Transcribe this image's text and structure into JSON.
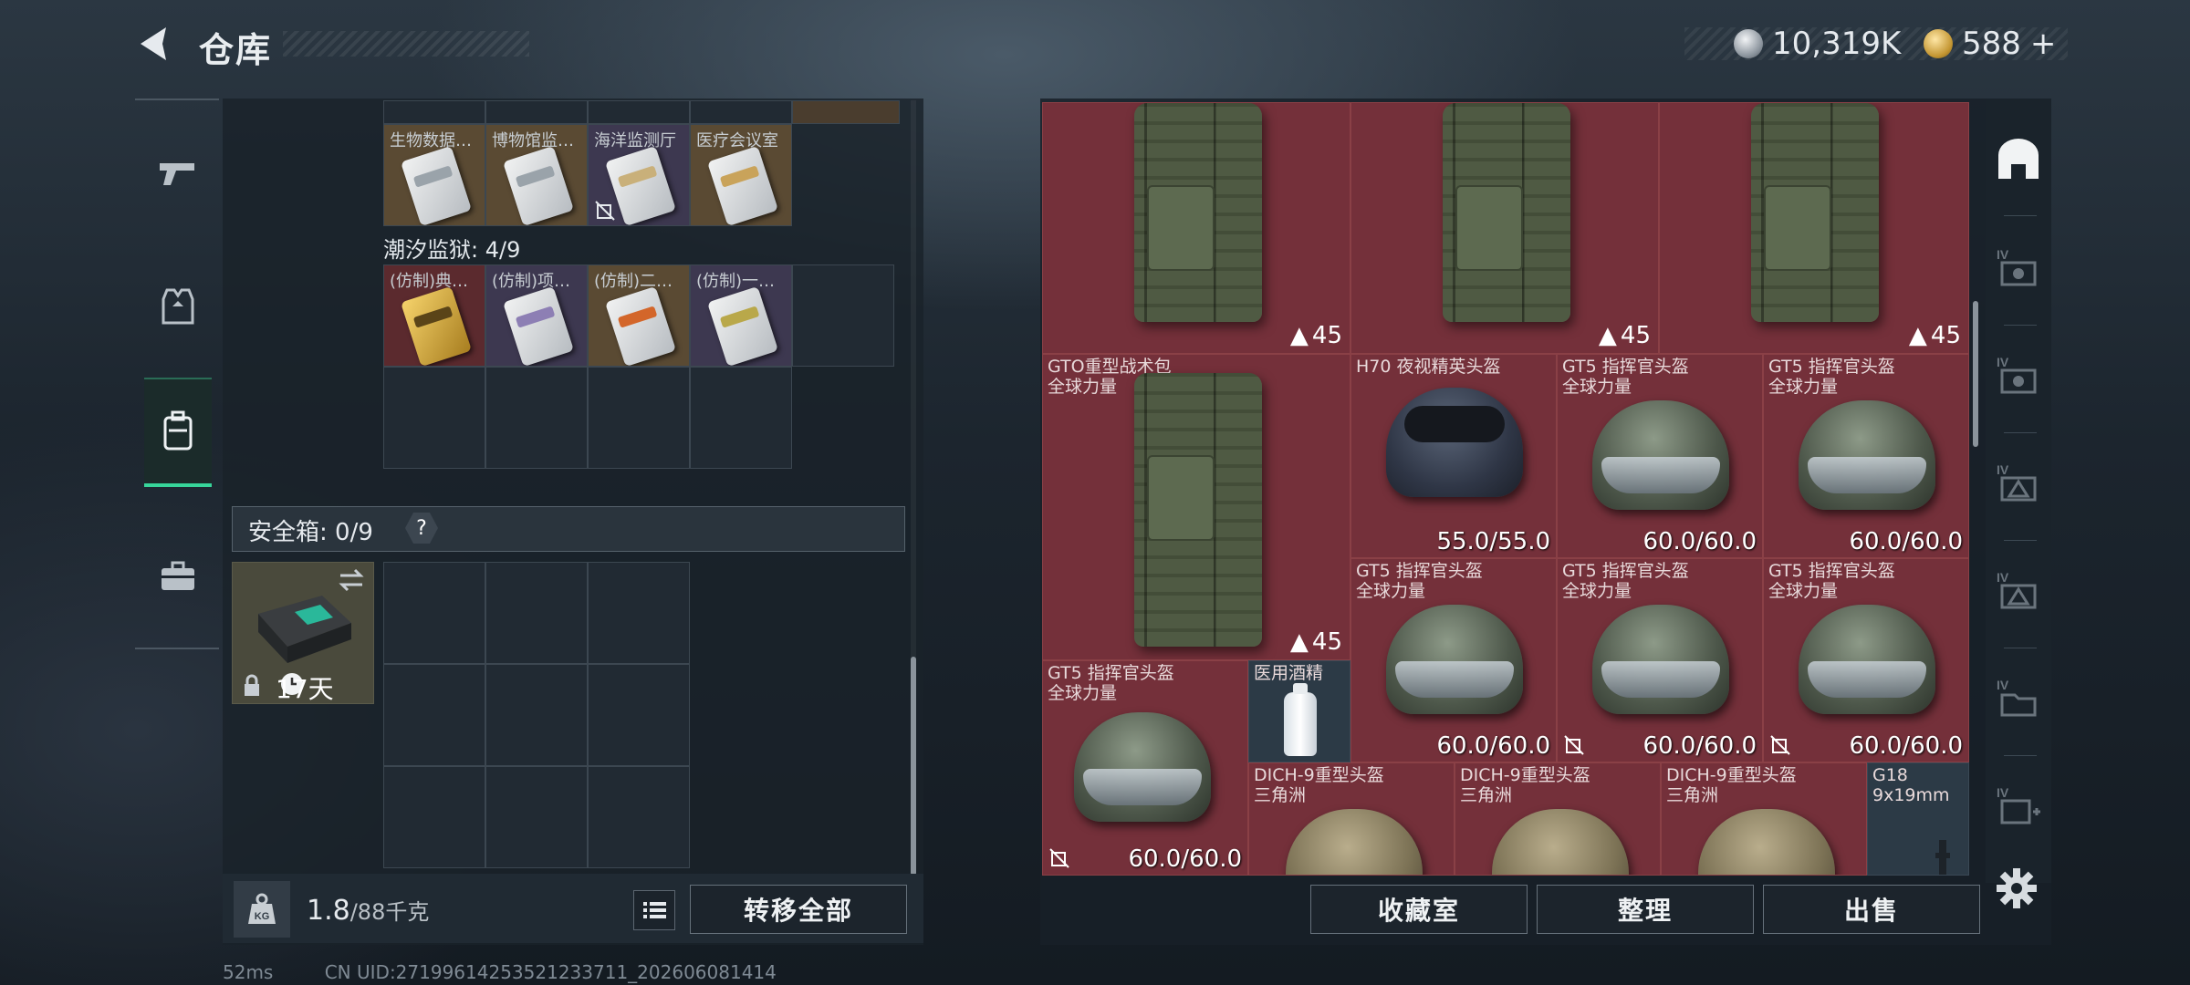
{
  "header": {
    "title": "仓库"
  },
  "currency": {
    "silver": "10,319K",
    "gold": "588",
    "gold_plus": "+"
  },
  "left": {
    "top_row_items": [
      {
        "label": "生物数据…",
        "bg": "gold",
        "card": "white"
      },
      {
        "label": "博物馆监…",
        "bg": "gold",
        "card": "white"
      },
      {
        "label": "海洋监测厅",
        "bg": "purple",
        "card": "white",
        "nodrop": true
      },
      {
        "label": "医疗会议室",
        "bg": "gold",
        "card": "white"
      }
    ],
    "prison_title": "潮汐监狱: 4/9",
    "prison_items": [
      {
        "label": "(仿制)典…",
        "bg": "red",
        "card": "gold"
      },
      {
        "label": "(仿制)项…",
        "bg": "purple",
        "card": "white"
      },
      {
        "label": "(仿制)二…",
        "bg": "gold",
        "card": "white"
      },
      {
        "label": "(仿制)一…",
        "bg": "purple",
        "card": "white"
      }
    ],
    "safe_label": "安全箱: 0/9",
    "safe_help": "?",
    "safe_box_timer": "17天",
    "weight_current": "1.8",
    "weight_max": "/88千克",
    "transfer_all": "转移全部"
  },
  "status": {
    "ping": "52ms",
    "uid": "CN UID:271996142535212337​11_202606081414"
  },
  "grid": {
    "backpacks_top": [
      {
        "capacity": "45"
      },
      {
        "capacity": "45"
      },
      {
        "capacity": "45"
      }
    ],
    "items": [
      {
        "id": "gto",
        "name": "GTO重型战术包",
        "sub": "全球力量",
        "capacity": "45"
      },
      {
        "id": "h70",
        "name": "H70 夜视精英头盔",
        "durability": "55.0/55.0"
      },
      {
        "id": "gt5a",
        "name": "GT5 指挥官头盔",
        "sub": "全球力量",
        "durability": "60.0/60.0"
      },
      {
        "id": "gt5b",
        "name": "GT5 指挥官头盔",
        "sub": "全球力量",
        "durability": "60.0/60.0"
      },
      {
        "id": "gt5c",
        "name": "GT5 指挥官头盔",
        "sub": "全球力量",
        "durability": "60.0/60.0"
      },
      {
        "id": "gt5d",
        "name": "GT5 指挥官头盔",
        "sub": "全球力量",
        "durability": "60.0/60.0"
      },
      {
        "id": "gt5e",
        "name": "GT5 指挥官头盔",
        "sub": "全球力量",
        "durability": "60.0/60.0"
      },
      {
        "id": "gt5f",
        "name": "GT5 指挥官头盔",
        "sub": "全球力量",
        "durability": "60.0/60.0"
      },
      {
        "id": "alcohol",
        "name": "医用酒精"
      },
      {
        "id": "dich1",
        "name": "DICH-9重型头盔",
        "sub": "三角洲"
      },
      {
        "id": "dich2",
        "name": "DICH-9重型头盔",
        "sub": "三角洲"
      },
      {
        "id": "dich3",
        "name": "DICH-9重型头盔",
        "sub": "三角洲"
      },
      {
        "id": "g18",
        "name": "G18",
        "sub": "9x19mm"
      }
    ]
  },
  "buttons": {
    "collection": "收藏室",
    "organize": "整理",
    "sell": "出售"
  },
  "colors": {
    "accent": "#37d69a",
    "item_red": "#74303a",
    "panel": "#1a222a"
  }
}
